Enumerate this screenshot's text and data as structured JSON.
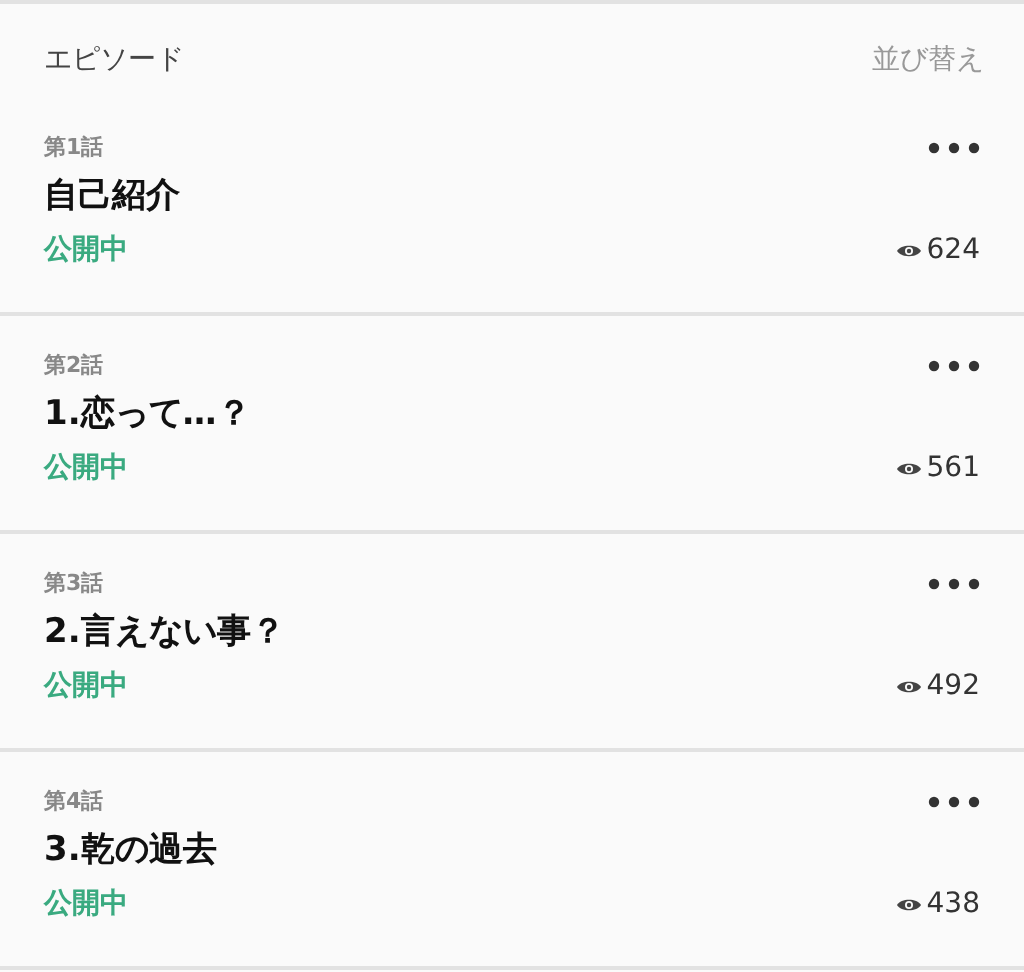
{
  "header": {
    "title": "エピソード",
    "sort_link": "並び替え"
  },
  "episodes": [
    {
      "number": "第1話",
      "title": "自己紹介",
      "status": "公開中",
      "views": "624"
    },
    {
      "number": "第2話",
      "title": "1.恋って…？",
      "status": "公開中",
      "views": "561"
    },
    {
      "number": "第3話",
      "title": "2.言えない事？",
      "status": "公開中",
      "views": "492"
    },
    {
      "number": "第4話",
      "title": "3.乾の過去",
      "status": "公開中",
      "views": "438"
    }
  ]
}
